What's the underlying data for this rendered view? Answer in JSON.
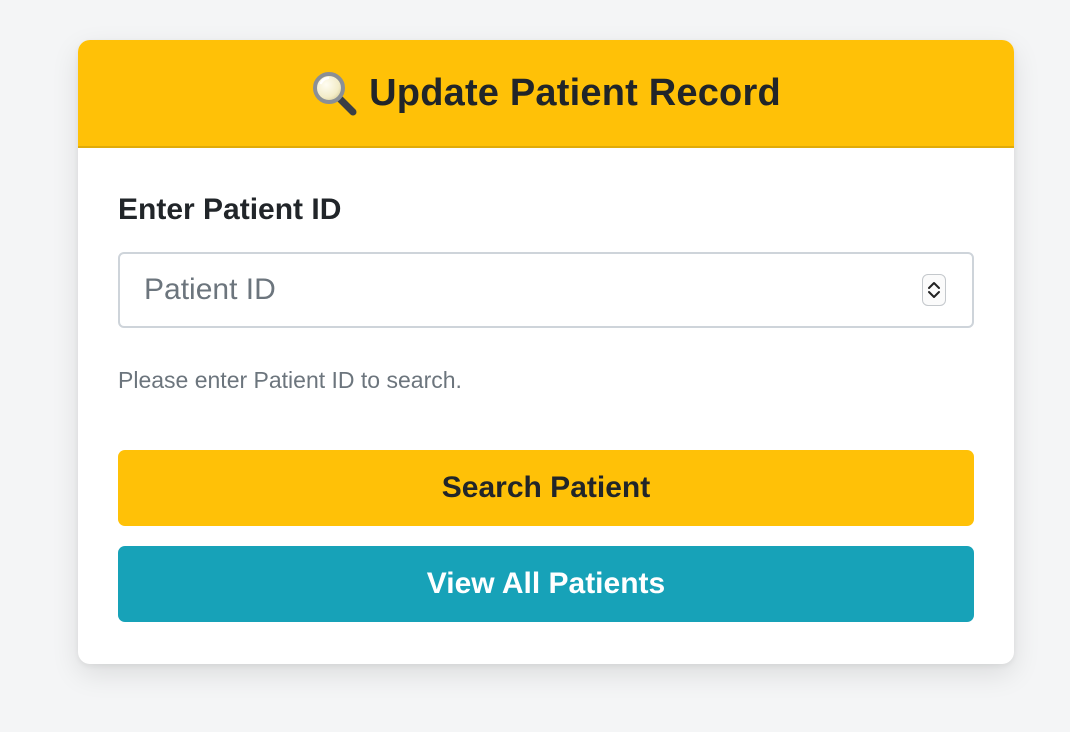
{
  "header": {
    "title": "Update Patient Record",
    "icon": "magnifying-glass-icon"
  },
  "form": {
    "label": "Enter Patient ID",
    "input": {
      "value": "",
      "placeholder": "Patient ID"
    },
    "help_text": "Please enter Patient ID to search."
  },
  "buttons": {
    "search_label": "Search Patient",
    "view_all_label": "View All Patients"
  },
  "colors": {
    "header_bg": "#ffc107",
    "search_bg": "#ffc107",
    "view_all_bg": "#17a2b8",
    "muted_text": "#6c757d"
  }
}
